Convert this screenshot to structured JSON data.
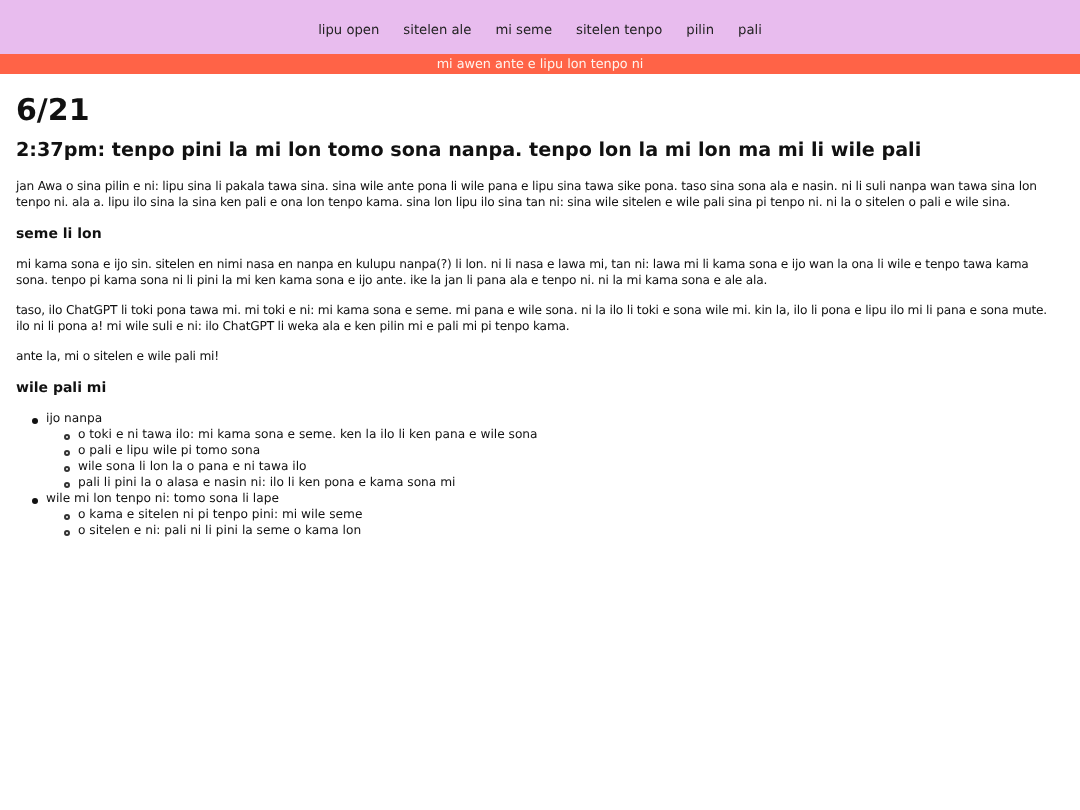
{
  "nav": {
    "items": [
      {
        "label": "lipu open"
      },
      {
        "label": "sitelen ale"
      },
      {
        "label": "mi seme"
      },
      {
        "label": "sitelen tenpo"
      },
      {
        "label": "pilin"
      },
      {
        "label": "pali"
      }
    ]
  },
  "banner": "mi awen ante e lipu lon tenpo ni",
  "title": "6/21",
  "subtitle": "2:37pm: tenpo pini la mi lon tomo sona nanpa. tenpo lon la mi lon ma mi li wile pali",
  "blocks": [
    {
      "kind": "paragraph",
      "text": "jan Awa o sina pilin e ni: lipu sina li pakala tawa sina. sina wile ante pona li wile pana e lipu sina tawa sike pona. taso sina sona ala e nasin. ni li suli nanpa wan tawa sina lon tenpo ni. ala a. lipu ilo sina la sina ken pali e ona lon tenpo kama. sina lon lipu ilo sina tan ni: sina wile sitelen e wile pali sina pi tenpo ni. ni la o sitelen o pali e wile sina."
    },
    {
      "kind": "heading",
      "text": "seme li lon"
    },
    {
      "kind": "paragraph",
      "text": "mi kama sona e ijo sin. sitelen en nimi nasa en nanpa en kulupu nanpa(?) li lon. ni li nasa e lawa mi, tan ni: lawa mi li kama sona e ijo wan la ona li wile e tenpo tawa kama sona. tenpo pi kama sona ni li pini la mi ken kama sona e ijo ante. ike la jan li pana ala e tenpo ni. ni la mi kama sona e ale ala."
    },
    {
      "kind": "paragraph",
      "text": "taso, ilo ChatGPT li toki pona tawa mi. mi toki e ni: mi kama sona e seme. mi pana e wile sona. ni la ilo li toki e sona wile mi. kin la, ilo li pona e lipu ilo mi li pana e sona mute. ilo ni li pona a! mi wile suli e ni: ilo ChatGPT li weka ala e ken pilin mi e pali mi pi tenpo kama."
    },
    {
      "kind": "paragraph",
      "text": "ante la, mi o sitelen e wile pali mi!"
    },
    {
      "kind": "heading",
      "text": "wile pali mi"
    },
    {
      "kind": "list",
      "items": [
        {
          "text": "ijo nanpa",
          "children": [
            {
              "text": "o toki e ni tawa ilo: mi kama sona e seme. ken la ilo li ken pana e wile sona"
            },
            {
              "text": "o pali e lipu wile pi tomo sona"
            },
            {
              "text": "wile sona li lon la o pana e ni tawa ilo"
            },
            {
              "text": "pali li pini la o alasa e nasin ni: ilo li ken pona e kama sona mi"
            }
          ]
        },
        {
          "text": "wile mi lon tenpo ni: tomo sona li lape",
          "children": [
            {
              "text": "o kama e sitelen ni pi tenpo pini: mi wile seme"
            },
            {
              "text": "o sitelen e ni: pali ni li pini la seme o kama lon"
            }
          ]
        }
      ]
    }
  ]
}
